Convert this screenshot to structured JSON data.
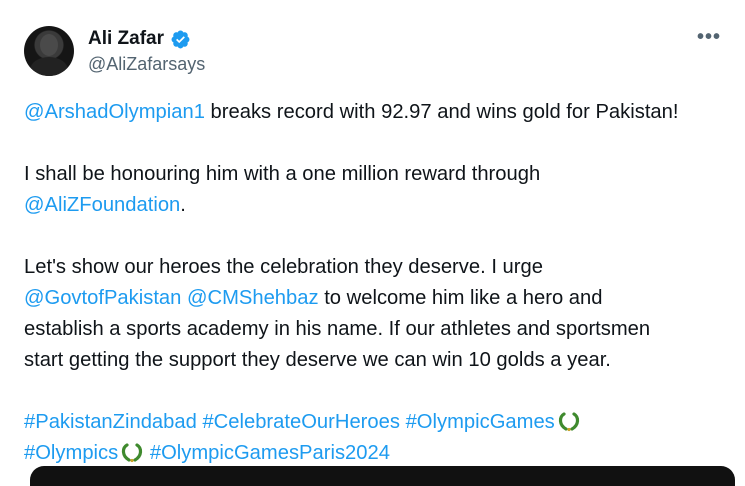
{
  "author": {
    "name": "Ali Zafar",
    "handle": "@AliZafarsays",
    "verified_color": "#1d9bf0"
  },
  "icons": {
    "more": "more-options-icon",
    "verified": "verified-badge-icon",
    "olympic": "olympic-wreath-emoji"
  },
  "tweet": {
    "line1": {
      "mention": "@ArshadOlympian1",
      "text": " breaks record with 92.97 and wins gold for Pakistan!"
    },
    "line2": "I shall be honouring him with a one million reward through",
    "line3": {
      "mention": "@AliZFoundation",
      "text": "."
    },
    "line4": "Let's show our heroes the celebration they deserve. I urge",
    "line5": {
      "mention1": "@GovtofPakistan",
      "mention2": "@CMShehbaz",
      "text": " to welcome him like a hero and"
    },
    "line6": "establish a sports academy in his name. If our athletes and sportsmen",
    "line7": "start getting the support they deserve we can win 10 golds a year.",
    "hashtags_line1": [
      "#PakistanZindabad",
      "#CelebrateOurHeroes",
      "#OlympicGames"
    ],
    "hashtags_line2": [
      "#Olympics",
      "#OlympicGamesParis2024"
    ]
  },
  "colors": {
    "link": "#1d9bf0",
    "text": "#0f1419",
    "secondary": "#536471"
  }
}
